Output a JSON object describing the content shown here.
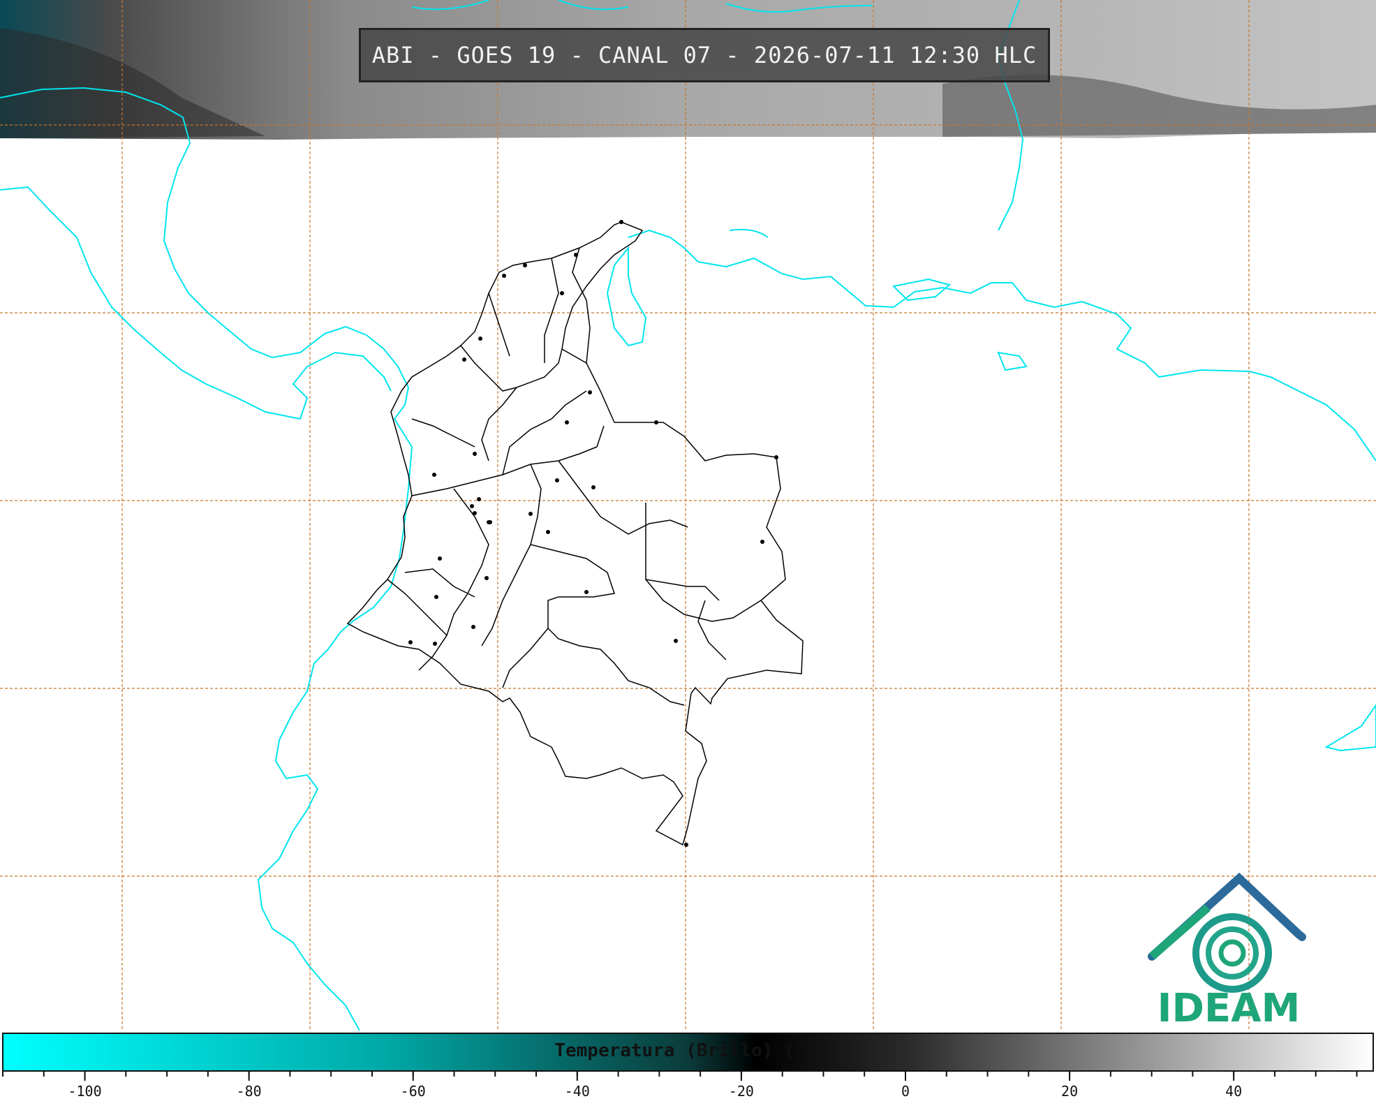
{
  "title": "ABI - GOES 19 - CANAL 07 - 2026-07-11 12:30 HLC",
  "logo": {
    "text": "IDEAM",
    "colors": [
      "#2b4f9a",
      "#1fa57a"
    ]
  },
  "colorbar": {
    "label": "Temperatura (Brillo) (°C)",
    "ticks": [
      "-100",
      "-80",
      "-60",
      "-40",
      "-20",
      "0",
      "20",
      "40"
    ],
    "tick_values": [
      -100,
      -80,
      -60,
      -40,
      -20,
      0,
      20,
      40
    ],
    "range": [
      -110,
      57
    ],
    "colors": [
      "#00ffff",
      "#007a78",
      "#000000",
      "#ffffff"
    ]
  },
  "map": {
    "coastline_color": "#00e5ee",
    "border_color": "#000000",
    "grid_color": "#c8762a",
    "satellite_band_colors": [
      "#0a4a56",
      "#5a5a5a",
      "#9a9a9a",
      "#c4c4c4"
    ]
  }
}
